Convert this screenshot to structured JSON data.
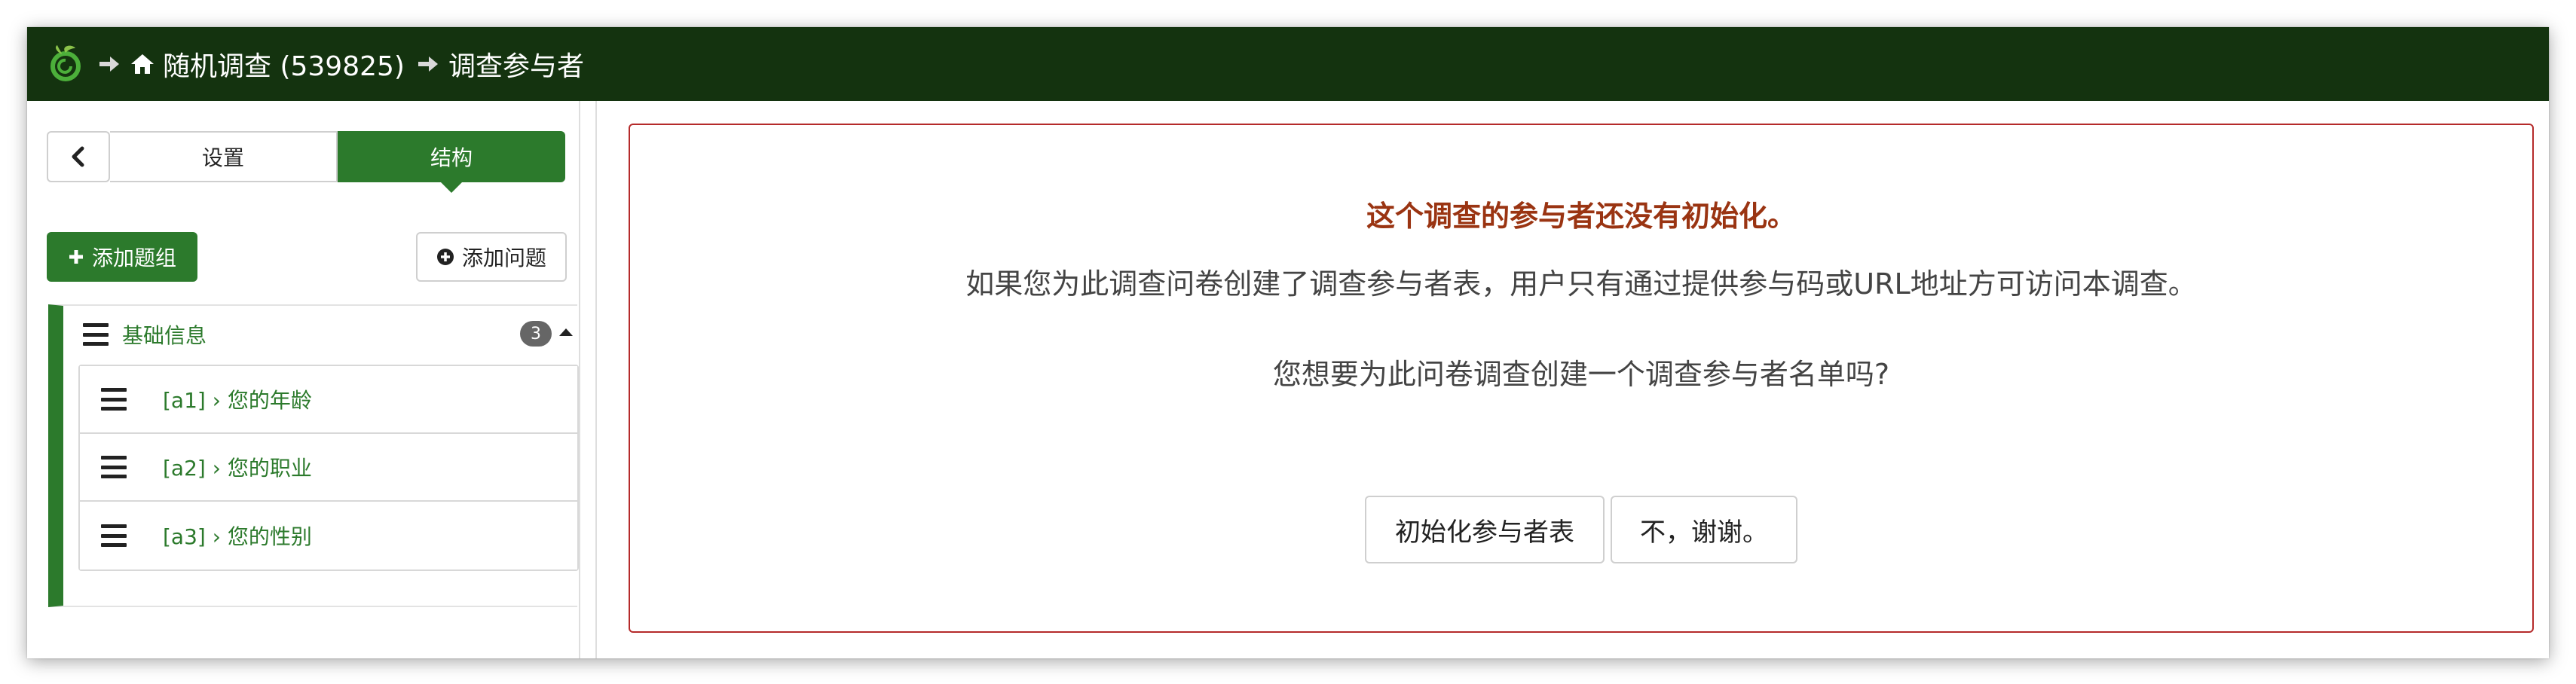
{
  "topbar": {
    "survey_crumb": "随机调查 (539825)",
    "page_crumb": "调查参与者"
  },
  "sidebar": {
    "tab_settings": "设置",
    "tab_structure": "结构",
    "add_group_label": "添加题组",
    "add_question_label": "添加问题",
    "group": {
      "title": "基础信息",
      "count": "3",
      "questions": [
        {
          "label": "[a1] › 您的年龄"
        },
        {
          "label": "[a2] › 您的职业"
        },
        {
          "label": "[a3] › 您的性别"
        }
      ]
    }
  },
  "alert": {
    "title": "这个调查的参与者还没有初始化。",
    "message": "如果您为此调查问卷创建了调查参与者表，用户只有通过提供参与码或URL地址方可访问本调查。",
    "question": "您想要为此问卷调查创建一个调查参与者名单吗?",
    "init_button": "初始化参与者表",
    "no_button": "不，谢谢。"
  },
  "colors": {
    "topbar_bg": "#14330f",
    "accent_green": "#2c7a2c",
    "alert_border": "#b52a2a",
    "alert_title": "#9a3412"
  }
}
